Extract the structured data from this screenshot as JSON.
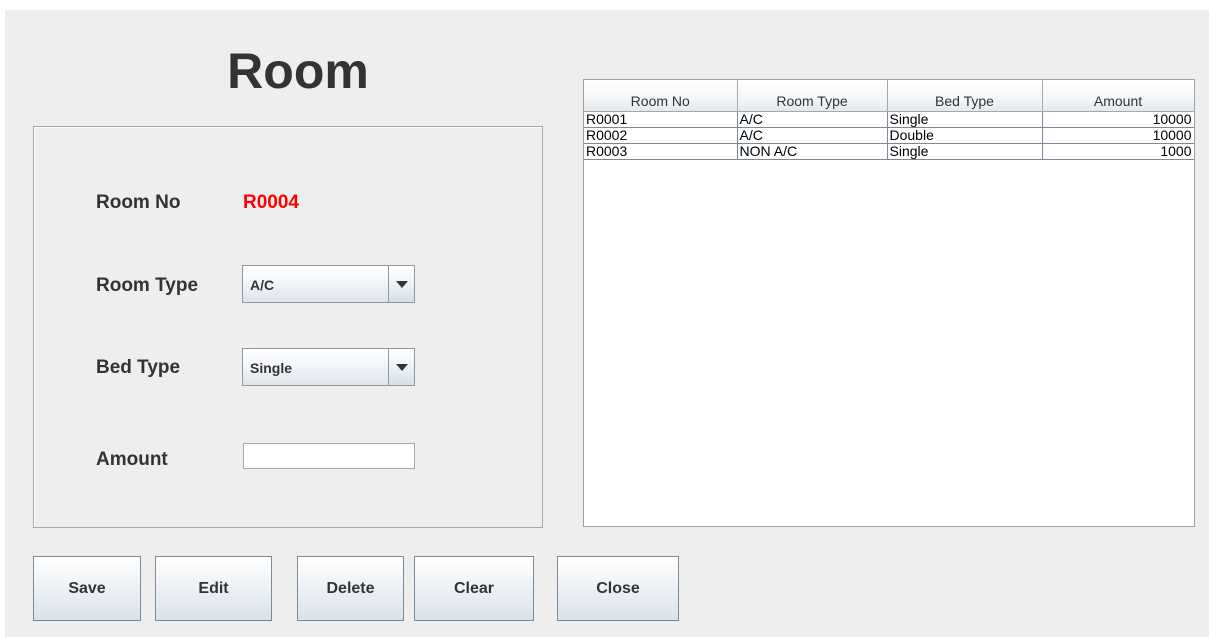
{
  "header": {
    "title": "Room"
  },
  "form": {
    "room_no_label": "Room No",
    "room_no_value": "R0004",
    "room_type_label": "Room Type",
    "room_type_value": "A/C",
    "bed_type_label": "Bed Type",
    "bed_type_value": "Single",
    "amount_label": "Amount",
    "amount_value": ""
  },
  "table": {
    "columns": [
      "Room No",
      "Room Type",
      "Bed Type",
      "Amount"
    ],
    "rows": [
      [
        "R0001",
        "A/C",
        "Single",
        "10000"
      ],
      [
        "R0002",
        "A/C",
        "Double",
        "10000"
      ],
      [
        "R0003",
        "NON A/C",
        "Single",
        "1000"
      ]
    ]
  },
  "buttons": {
    "save": "Save",
    "edit": "Edit",
    "delete": "Delete",
    "clear": "Clear",
    "close": "Close"
  },
  "colors": {
    "room_no_value": "#ff0000",
    "background": "#eeeeee"
  },
  "icons": {
    "combo_arrow": "chevron-down-icon"
  }
}
